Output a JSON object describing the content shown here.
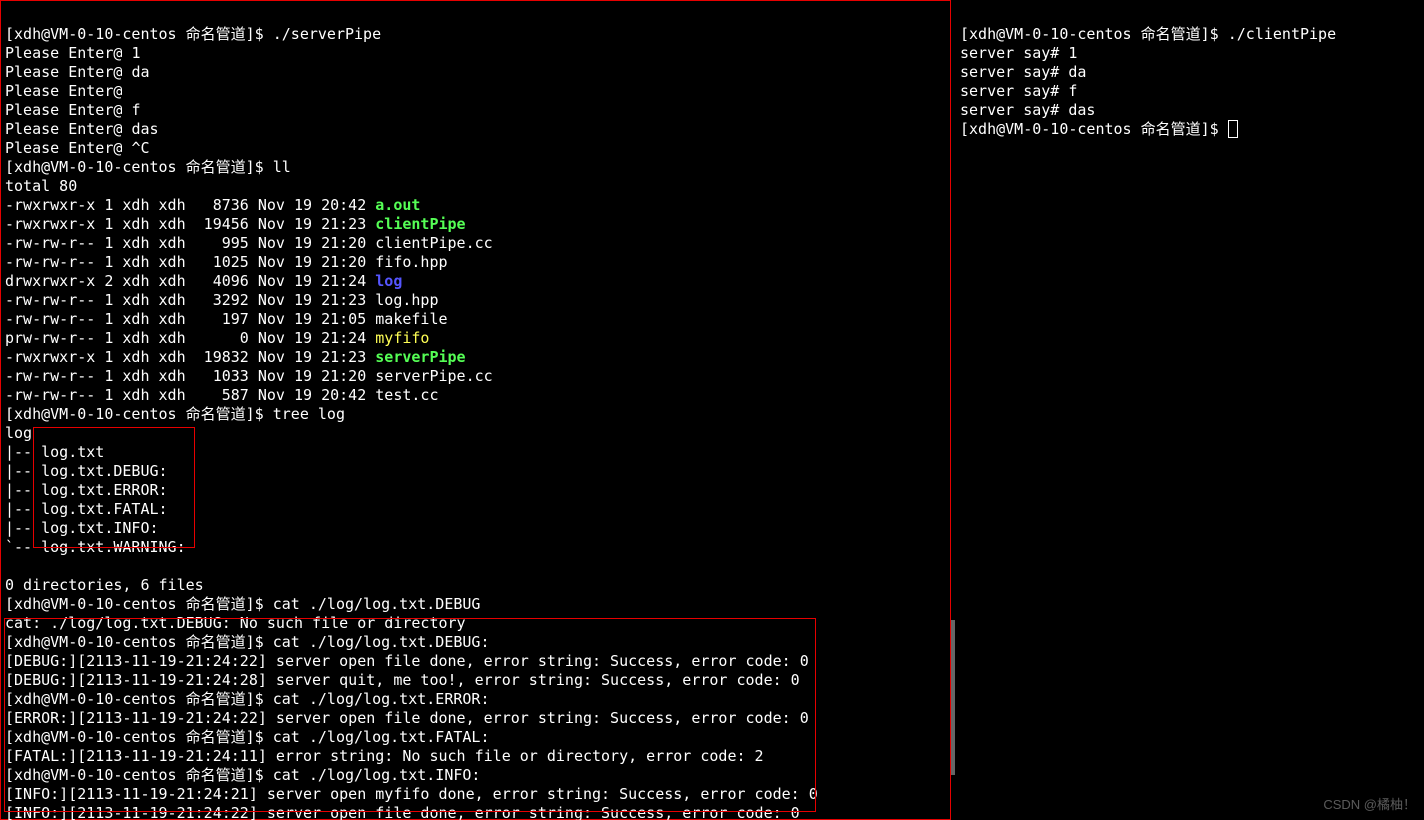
{
  "left": {
    "p_user": "xdh@VM-0-10-centos",
    "p_dir": "命名管道",
    "cmd1": "./serverPipe",
    "enter": "Please Enter@ ",
    "e1": "1",
    "e2": "da",
    "e3": "",
    "e4": "f",
    "e5": "das",
    "e6": "^C",
    "cmd2": "ll",
    "total": "total 80",
    "ls": [
      {
        "perm": "-rwxrwxr-x 1 xdh xdh   8736 Nov 19 20:42 ",
        "name": "a.out",
        "cls": "exec-green"
      },
      {
        "perm": "-rwxrwxr-x 1 xdh xdh  19456 Nov 19 21:23 ",
        "name": "clientPipe",
        "cls": "exec-green"
      },
      {
        "perm": "-rw-rw-r-- 1 xdh xdh    995 Nov 19 21:20 ",
        "name": "clientPipe.cc",
        "cls": ""
      },
      {
        "perm": "-rw-rw-r-- 1 xdh xdh   1025 Nov 19 21:20 ",
        "name": "fifo.hpp",
        "cls": ""
      },
      {
        "perm": "drwxrwxr-x 2 xdh xdh   4096 Nov 19 21:24 ",
        "name": "log",
        "cls": "dir-blue"
      },
      {
        "perm": "-rw-rw-r-- 1 xdh xdh   3292 Nov 19 21:23 ",
        "name": "log.hpp",
        "cls": ""
      },
      {
        "perm": "-rw-rw-r-- 1 xdh xdh    197 Nov 19 21:05 ",
        "name": "makefile",
        "cls": ""
      },
      {
        "perm": "prw-rw-r-- 1 xdh xdh      0 Nov 19 21:24 ",
        "name": "myfifo",
        "cls": "pipe-yellow"
      },
      {
        "perm": "-rwxrwxr-x 1 xdh xdh  19832 Nov 19 21:23 ",
        "name": "serverPipe",
        "cls": "exec-green"
      },
      {
        "perm": "-rw-rw-r-- 1 xdh xdh   1033 Nov 19 21:20 ",
        "name": "serverPipe.cc",
        "cls": ""
      },
      {
        "perm": "-rw-rw-r-- 1 xdh xdh    587 Nov 19 20:42 ",
        "name": "test.cc",
        "cls": ""
      }
    ],
    "cmd3": "tree log",
    "tree_root": "log",
    "tree": [
      "|-- log.txt",
      "|-- log.txt.DEBUG:",
      "|-- log.txt.ERROR:",
      "|-- log.txt.FATAL:",
      "|-- log.txt.INFO:",
      "`-- log.txt.WARNING:"
    ],
    "tree_sum": "0 directories, 6 files",
    "cmd4": "cat ./log/log.txt.DEBUG",
    "cat_err": "cat: ./log/log.txt.DEBUG: No such file or directory",
    "cmd5": "cat ./log/log.txt.DEBUG:",
    "dbg1": "[DEBUG:][2113-11-19-21:24:22] server open file done, error string: Success, error code: 0",
    "dbg2": "[DEBUG:][2113-11-19-21:24:28] server quit, me too!, error string: Success, error code: 0",
    "cmd6": "cat ./log/log.txt.ERROR:",
    "err1": "[ERROR:][2113-11-19-21:24:22] server open file done, error string: Success, error code: 0",
    "cmd7": "cat ./log/log.txt.FATAL:",
    "fat1": "[FATAL:][2113-11-19-21:24:11] error string: No such file or directory, error code: 2",
    "cmd8": "cat ./log/log.txt.INFO:",
    "inf1": "[INFO:][2113-11-19-21:24:21] server open myfifo done, error string: Success, error code: 0",
    "inf2": "[INFO:][2113-11-19-21:24:22] server open file done, error string: Success, error code: 0"
  },
  "right": {
    "p_user": "xdh@VM-0-10-centos",
    "p_dir": "命名管道",
    "cmd1": "./clientPipe",
    "say": "server say# ",
    "s1": "1",
    "s2": "da",
    "s3": "f",
    "s4": "das"
  },
  "watermark": "CSDN @橘柚！"
}
